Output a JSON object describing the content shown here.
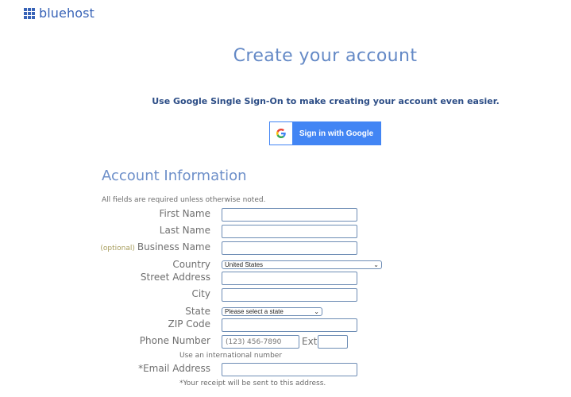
{
  "brand": {
    "name": "bluehost",
    "color": "#3863b7"
  },
  "header": {
    "title": "Create your account"
  },
  "sso": {
    "prompt": "Use Google Single Sign-On to make creating your account even easier.",
    "button_label": "Sign in with Google",
    "button_icon": "google-icon",
    "button_color": "#4285f4"
  },
  "account": {
    "section_title": "Account Information",
    "required_note": "All fields are required unless otherwise noted.",
    "fields": {
      "first_name": {
        "label": "First Name",
        "value": ""
      },
      "last_name": {
        "label": "Last Name",
        "value": ""
      },
      "business_name": {
        "optional_tag": "(optional)",
        "label": "Business Name",
        "value": ""
      },
      "country": {
        "label": "Country",
        "selected": "United States"
      },
      "street_address": {
        "label": "Street Address",
        "value": ""
      },
      "city": {
        "label": "City",
        "value": ""
      },
      "state": {
        "label": "State",
        "selected": "Please select a state"
      },
      "zip": {
        "label": "ZIP Code",
        "value": ""
      },
      "phone": {
        "label": "Phone Number",
        "placeholder": "(123) 456-7890",
        "ext_label": "Ext",
        "ext_value": "",
        "intl_link": "Use an international number"
      },
      "email": {
        "label": "*Email Address",
        "value": "",
        "note": "*Your receipt will be sent to this address."
      }
    }
  }
}
